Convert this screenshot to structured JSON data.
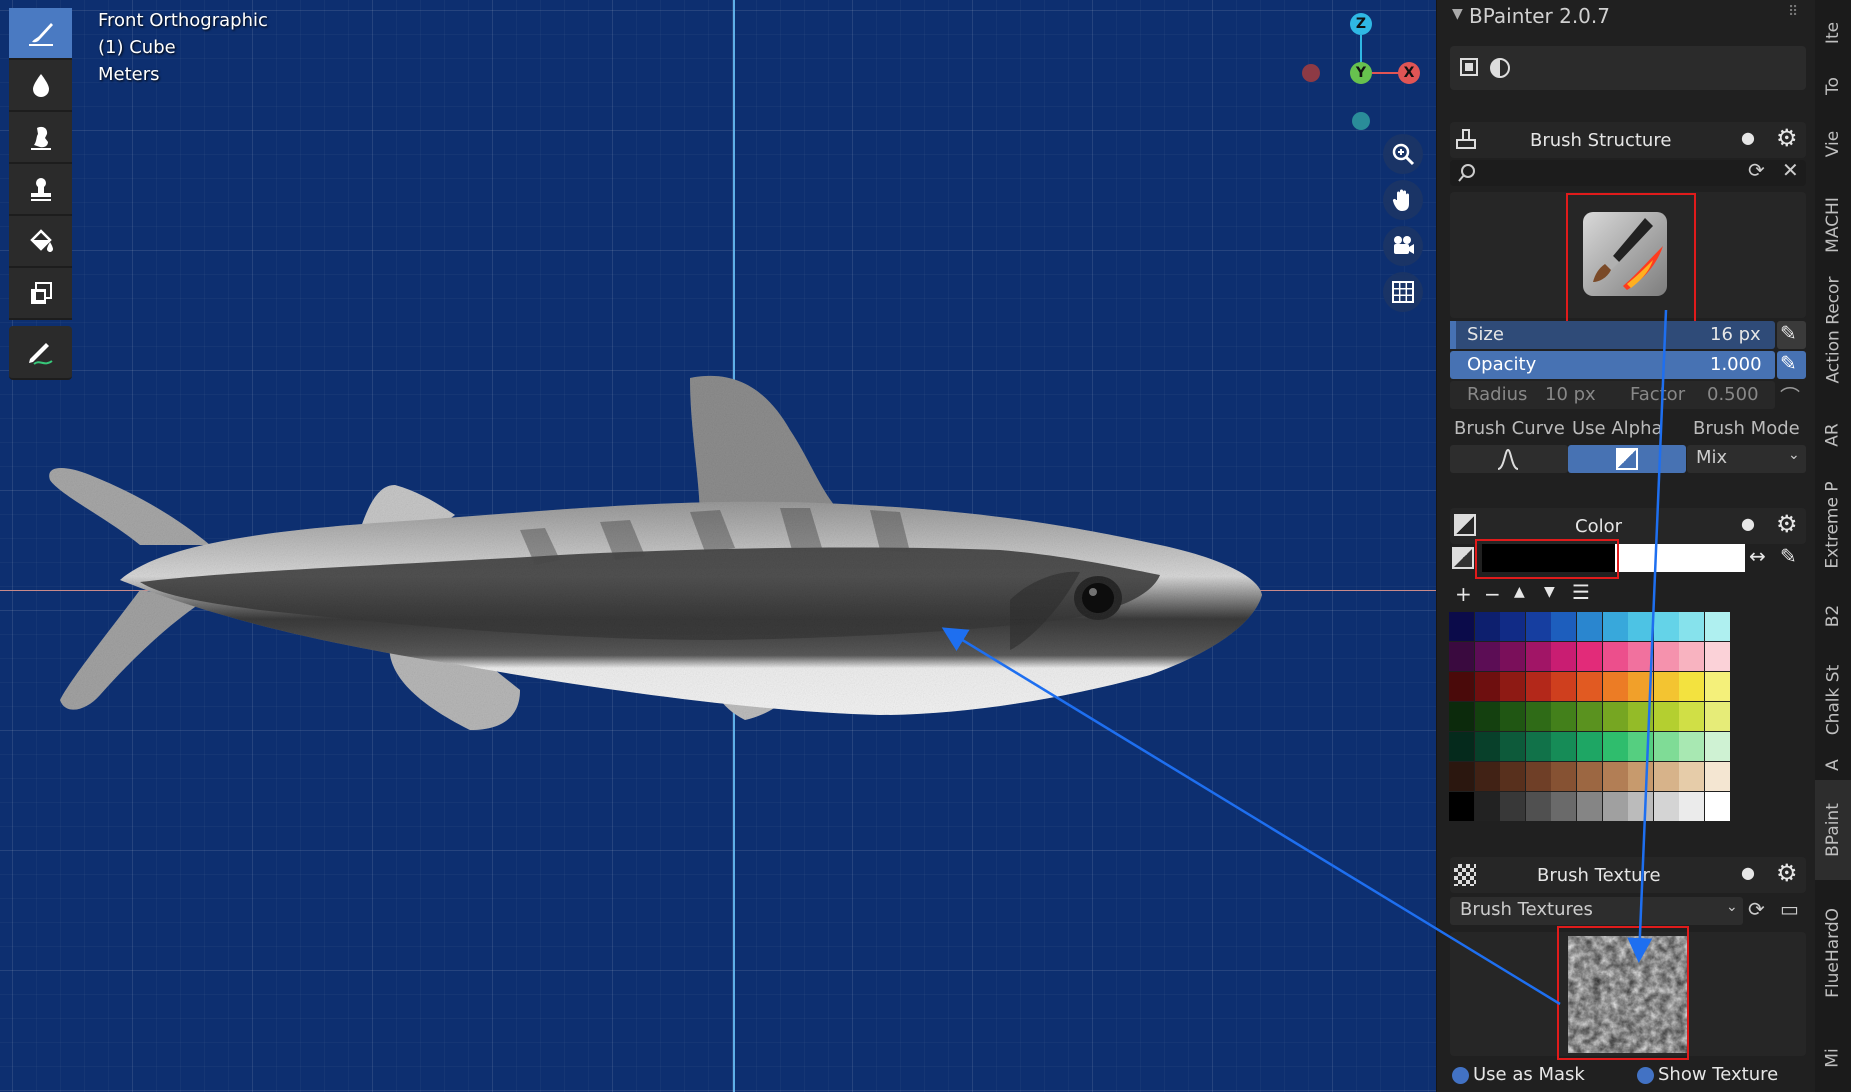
{
  "viewport": {
    "view_name": "Front Orthographic",
    "object": "(1) Cube",
    "units": "Meters",
    "gizmo": {
      "z": "Z",
      "y": "Y",
      "x": "X"
    }
  },
  "toolbar": {
    "tools": [
      "draw-brush-icon",
      "soften-icon",
      "smear-icon",
      "clone-stamp-icon",
      "fill-icon",
      "mask-icon"
    ],
    "active_tool": "draw-brush-icon",
    "annotate_tool": "annotate-icon"
  },
  "panel": {
    "title": "BPainter 2.0.7",
    "brush_structure": {
      "title": "Brush Structure",
      "size_label": "Size",
      "size_value": "16 px",
      "opacity_label": "Opacity",
      "opacity_value": "1.000",
      "radius_label": "Radius",
      "radius_value": "10 px",
      "factor_label": "Factor",
      "factor_value": "0.500",
      "brush_curve_label": "Brush Curve",
      "use_alpha_label": "Use Alpha",
      "brush_mode_label": "Brush Mode",
      "brush_mode_value": "Mix"
    },
    "color": {
      "title": "Color",
      "primary": "#000000",
      "secondary": "#ffffff",
      "palette": [
        [
          "#0b0b4a",
          "#0d1f6e",
          "#112b86",
          "#163ea0",
          "#1d5ebd",
          "#2a86cf",
          "#38a8db",
          "#4dc3e4",
          "#64d3e8",
          "#86e2ec",
          "#aff0f0"
        ],
        [
          "#3a0a3f",
          "#5c0d55",
          "#7a0f5a",
          "#a11566",
          "#c91d72",
          "#e22b79",
          "#ec4f8c",
          "#f1719e",
          "#f592ad",
          "#f8b3c0",
          "#fbd2d8"
        ],
        [
          "#4a0a0a",
          "#6e0f0f",
          "#8e1a14",
          "#b3281a",
          "#cf3f1e",
          "#e15a22",
          "#ec7c25",
          "#f1a02a",
          "#f3c431",
          "#f3e23f",
          "#f4f07a"
        ],
        [
          "#0c2a0c",
          "#14400f",
          "#205613",
          "#2f6b17",
          "#43801b",
          "#5a921f",
          "#76a622",
          "#94bb28",
          "#b4cf30",
          "#d0df46",
          "#e6ec78"
        ],
        [
          "#052a1c",
          "#08402a",
          "#0d5a3a",
          "#117249",
          "#168c57",
          "#1ea664",
          "#2fbd6d",
          "#55cf80",
          "#7fdc96",
          "#a8e8b2",
          "#cff2d3"
        ],
        [
          "#2b170f",
          "#412215",
          "#58301d",
          "#6f3f27",
          "#865233",
          "#9c6742",
          "#b27e55",
          "#c79a6d",
          "#d7b38a",
          "#e6cca9",
          "#f4e6d2"
        ],
        [
          "#000000",
          "#222222",
          "#383838",
          "#505050",
          "#6a6a6a",
          "#858585",
          "#a0a0a0",
          "#bbbbbb",
          "#d4d4d4",
          "#ebebeb",
          "#ffffff"
        ]
      ]
    },
    "brush_texture": {
      "title": "Brush Texture",
      "dropdown": "Brush Textures",
      "use_as_mask": "Use as Mask",
      "show_texture": "Show Texture"
    }
  },
  "tabs": [
    "Ite",
    "To",
    "Vie",
    "MACHI",
    "Action Recor",
    "AR",
    "Extreme P",
    "B2",
    "Chalk St",
    "A",
    "BPaint",
    "HardO",
    "Flue",
    "Mi"
  ],
  "active_tab": "BPaint"
}
